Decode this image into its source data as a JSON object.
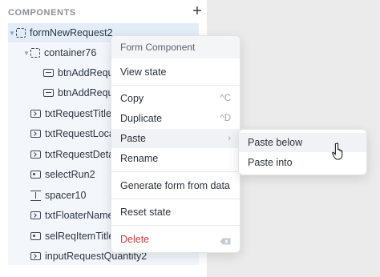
{
  "panel": {
    "title": "COMPONENTS",
    "add_label": "+"
  },
  "tree": [
    {
      "label": "formNewRequest2",
      "icon": "container-icon",
      "selected": true
    },
    {
      "label": "container76",
      "icon": "container-icon"
    },
    {
      "label": "btnAddRequ",
      "icon": "button-icon"
    },
    {
      "label": "btnAddRequ",
      "icon": "button-icon"
    },
    {
      "label": "txtRequestTitle",
      "icon": "text-input-icon"
    },
    {
      "label": "txtRequestLoca",
      "icon": "text-input-icon"
    },
    {
      "label": "txtRequestDeta",
      "icon": "text-input-icon"
    },
    {
      "label": "selectRun2",
      "icon": "select-icon"
    },
    {
      "label": "spacer10",
      "icon": "spacer-icon"
    },
    {
      "label": "txtFloaterName",
      "icon": "text-input-icon"
    },
    {
      "label": "selReqItemTitle",
      "icon": "select-icon"
    },
    {
      "label": "inputRequestQuantity2",
      "icon": "text-input-icon"
    }
  ],
  "context_menu": {
    "header": "Form Component",
    "items": {
      "view_state": "View state",
      "copy": "Copy",
      "copy_shortcut": "^C",
      "duplicate": "Duplicate",
      "duplicate_shortcut": "^D",
      "paste": "Paste",
      "rename": "Rename",
      "generate": "Generate form from data",
      "reset": "Reset state",
      "delete": "Delete"
    }
  },
  "paste_submenu": {
    "paste_below": "Paste below",
    "paste_into": "Paste into"
  },
  "colors": {
    "selected_row": "#e2edf9",
    "tree_background": "#f3f7fc",
    "delete_text": "#d23c3c",
    "right_pane": "#ebebeb"
  }
}
